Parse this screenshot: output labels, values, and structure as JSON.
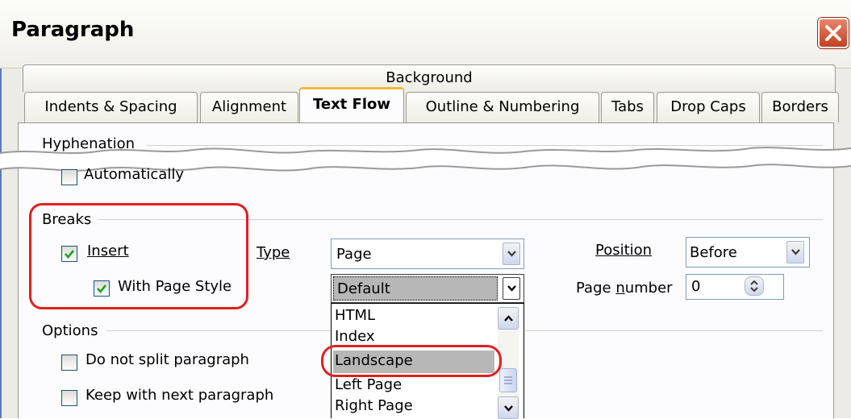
{
  "dialog": {
    "title": "Paragraph"
  },
  "tabs": {
    "row1": [
      "Background"
    ],
    "row2": [
      "Indents & Spacing",
      "Alignment",
      "Text Flow",
      "Outline & Numbering",
      "Tabs",
      "Drop Caps",
      "Borders"
    ],
    "active": "Text Flow"
  },
  "hyphenation": {
    "title": "Hyphenation",
    "automatically_label": "Automatically",
    "automatically_checked": false
  },
  "breaks": {
    "title": "Breaks",
    "insert_label": "Insert",
    "insert_checked": true,
    "type_label": "Type",
    "type_value": "Page",
    "position_label": "Position",
    "position_value": "Before",
    "with_page_style_label": "With Page Style",
    "with_page_style_checked": true,
    "page_style_value": "Default",
    "page_number_label": "Page number",
    "page_number_value": "0",
    "page_style_options": [
      "HTML",
      "Index",
      "Landscape",
      "Left Page",
      "Right Page"
    ],
    "page_style_highlighted": "Landscape"
  },
  "options": {
    "title": "Options",
    "dont_split_label": "Do not split paragraph",
    "dont_split_checked": false,
    "keep_next_label": "Keep with next paragraph",
    "keep_next_checked": false
  },
  "colors": {
    "accent_tab": "#f4b940",
    "callout": "#e02020",
    "selection": "#b7b7b7"
  }
}
